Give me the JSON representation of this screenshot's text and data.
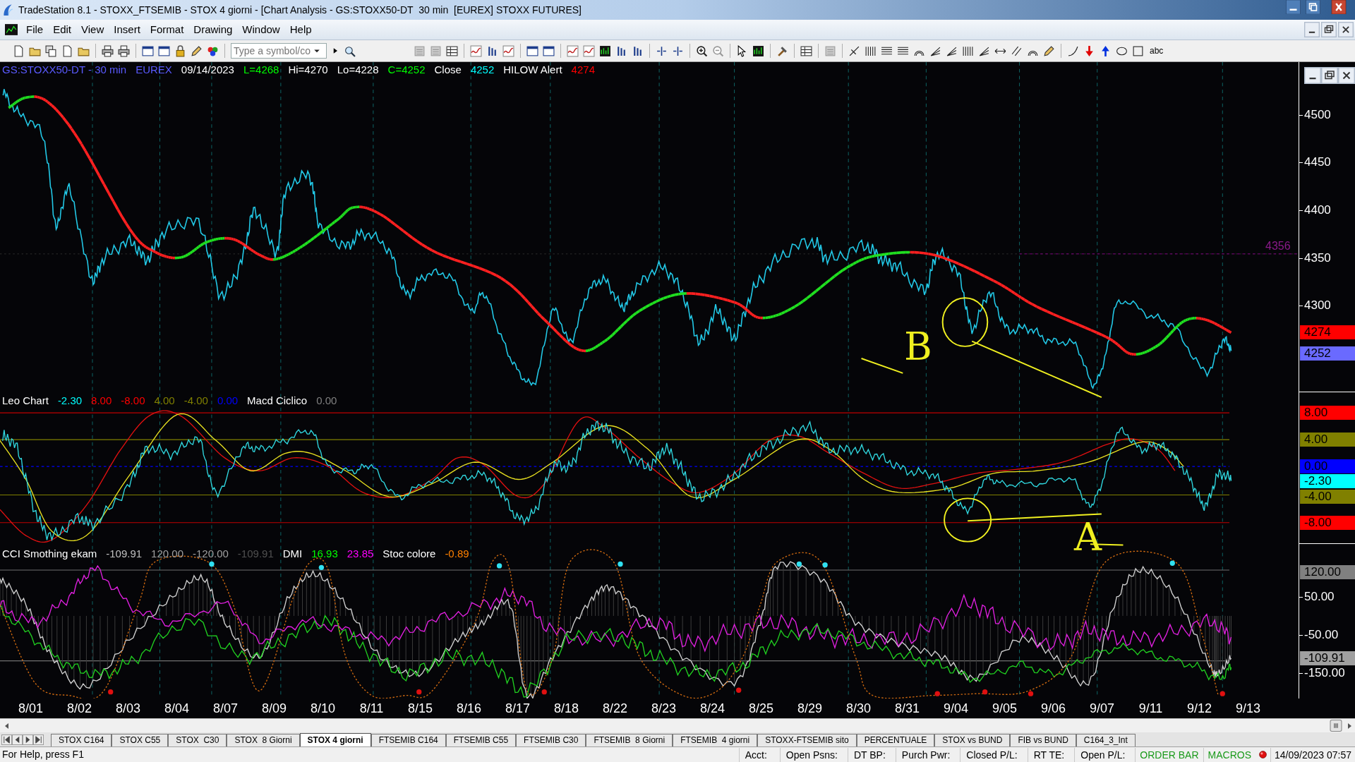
{
  "window": {
    "title": "TradeStation 8.1 - STOXX_FTSEMIB - STOX 4 giorni - [Chart Analysis - GS:STOXX50-DT  30 min  [EUREX] STOXX FUTURES]"
  },
  "menu": [
    "File",
    "Edit",
    "View",
    "Insert",
    "Format",
    "Drawing",
    "Window",
    "Help"
  ],
  "toolbar": {
    "symbol_field": {
      "placeholder": "Type a symbol/co"
    },
    "text_tool": "abc"
  },
  "chart": {
    "price_pane": {
      "legend": [
        {
          "text": "GS:STOXX50-DT - 30 min",
          "color": "#5a5aff"
        },
        {
          "text": "EUREX",
          "color": "#5a5aff"
        },
        {
          "text": "09/14/2023",
          "color": "#ffffff"
        },
        {
          "text": "L=4268",
          "color": "#00ff00"
        },
        {
          "text": "Hi=4270",
          "color": "#ffffff"
        },
        {
          "text": "Lo=4228",
          "color": "#ffffff"
        },
        {
          "text": "C=4252",
          "color": "#00ff00"
        },
        {
          "text": "Close",
          "color": "#ffffff"
        },
        {
          "text": "4252",
          "color": "#00ffff"
        },
        {
          "text": "HILOW Alert",
          "color": "#ffffff"
        },
        {
          "text": "4274",
          "color": "#ff0000"
        }
      ],
      "level_label": "4356",
      "axis_labels": [
        {
          "text": "4500",
          "kind": "tick"
        },
        {
          "text": "4450",
          "kind": "tick"
        },
        {
          "text": "4400",
          "kind": "tick"
        },
        {
          "text": "4350",
          "kind": "tick"
        },
        {
          "text": "4300",
          "kind": "tick"
        },
        {
          "text": "4274",
          "kind": "tag",
          "color": "#ff0000"
        },
        {
          "text": "4252",
          "kind": "tag",
          "color": "#6a6aff"
        }
      ]
    },
    "oscillator_pane": {
      "legend": [
        {
          "text": "Leo Chart",
          "color": "#ffffff"
        },
        {
          "text": "-2.30",
          "color": "#00ffff"
        },
        {
          "text": "8.00",
          "color": "#ff0000"
        },
        {
          "text": "-8.00",
          "color": "#ff0000"
        },
        {
          "text": "4.00",
          "color": "#808000"
        },
        {
          "text": "-4.00",
          "color": "#808000"
        },
        {
          "text": "0.00",
          "color": "#0000ff"
        },
        {
          "text": "Macd Ciclico",
          "color": "#ffffff"
        },
        {
          "text": "0.00",
          "color": "#808080"
        }
      ],
      "axis_labels": [
        {
          "text": "8.00",
          "kind": "tag",
          "color": "#ff0000"
        },
        {
          "text": "4.00",
          "kind": "tag",
          "color": "#808000"
        },
        {
          "text": "0.00",
          "kind": "tag",
          "color": "#0000ff"
        },
        {
          "text": "-2.30",
          "kind": "tag",
          "color": "#00ffff"
        },
        {
          "text": "-4.00",
          "kind": "tag",
          "color": "#808000"
        },
        {
          "text": "-8.00",
          "kind": "tag",
          "color": "#ff0000"
        }
      ]
    },
    "cci_pane": {
      "legend": [
        {
          "text": "CCI Smothing ekam",
          "color": "#ffffff"
        },
        {
          "text": "-109.91",
          "color": "#c0c0c0"
        },
        {
          "text": "120.00",
          "color": "#a0a0a0"
        },
        {
          "text": "-120.00",
          "color": "#a0a0a0"
        },
        {
          "text": "-109.91",
          "color": "#505050"
        },
        {
          "text": "DMI",
          "color": "#ffffff"
        },
        {
          "text": "16.93",
          "color": "#00ff00"
        },
        {
          "text": "23.85",
          "color": "#ff00ff"
        },
        {
          "text": "Stoc colore",
          "color": "#ffffff"
        },
        {
          "text": "-0.89",
          "color": "#ff8000"
        }
      ],
      "axis_labels": [
        {
          "text": "120.00",
          "kind": "tag",
          "color": "#808080"
        },
        {
          "text": "50.00",
          "kind": "tick"
        },
        {
          "text": "-50.00",
          "kind": "tick"
        },
        {
          "text": "-109.91",
          "kind": "tag",
          "color": "#a0a0a0"
        },
        {
          "text": "-150.00",
          "kind": "tick"
        }
      ]
    },
    "handwritten_annotations": [
      "B",
      "A"
    ],
    "dates": [
      "8/01",
      "8/02",
      "8/03",
      "8/04",
      "8/07",
      "8/09",
      "8/10",
      "8/11",
      "8/15",
      "8/16",
      "8/17",
      "8/18",
      "8/22",
      "8/23",
      "8/24",
      "8/25",
      "8/29",
      "8/30",
      "8/31",
      "9/04",
      "9/05",
      "9/06",
      "9/07",
      "9/11",
      "9/12",
      "9/13"
    ]
  },
  "sheet_tabs": [
    {
      "label": "STOX C164",
      "selected": false
    },
    {
      "label": "STOX C55",
      "selected": false
    },
    {
      "label": "STOX  C30",
      "selected": false
    },
    {
      "label": "STOX  8 Giorni",
      "selected": false
    },
    {
      "label": "STOX 4 giorni",
      "selected": true
    },
    {
      "label": "FTSEMIB C164",
      "selected": false
    },
    {
      "label": "FTSEMIB C55",
      "selected": false
    },
    {
      "label": "FTSEMIB C30",
      "selected": false
    },
    {
      "label": "FTSEMIB  8 Giorni",
      "selected": false
    },
    {
      "label": "FTSEMIB  4 giorni",
      "selected": false
    },
    {
      "label": "STOXX-FTSEMIB sito",
      "selected": false
    },
    {
      "label": "PERCENTUALE",
      "selected": false
    },
    {
      "label": "STOX vs BUND",
      "selected": false
    },
    {
      "label": "FIB vs BUND",
      "selected": false
    },
    {
      "label": "C164_3_Int",
      "selected": false
    }
  ],
  "status_bar": {
    "help": "For Help, press F1",
    "fields": [
      "Acct:",
      "Open Psns:",
      "DT BP:",
      "Purch Pwr:",
      "Closed P/L:",
      "RT TE:",
      "Open P/L:"
    ],
    "indicators": [
      "ORDER BAR",
      "MACROS"
    ],
    "datetime": "14/09/2023 07:57"
  }
}
